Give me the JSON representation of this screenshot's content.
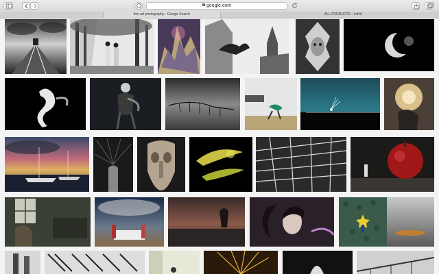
{
  "browser": {
    "url": "google.com",
    "tabs": [
      {
        "label": "fine art photography - Google Search",
        "active": true
      },
      {
        "label": "ALL PRODUCTS - LoHit",
        "active": false
      }
    ],
    "icons": [
      "sidebar-icon",
      "back-icon",
      "forward-icon",
      "privacy-icon",
      "reload-icon",
      "share-icon",
      "tabs-overview-icon",
      "lock-icon"
    ]
  },
  "results": {
    "colors": {
      "page_bg": "#f4f4f4",
      "toolbar_bg": "#e3e3e3"
    }
  }
}
